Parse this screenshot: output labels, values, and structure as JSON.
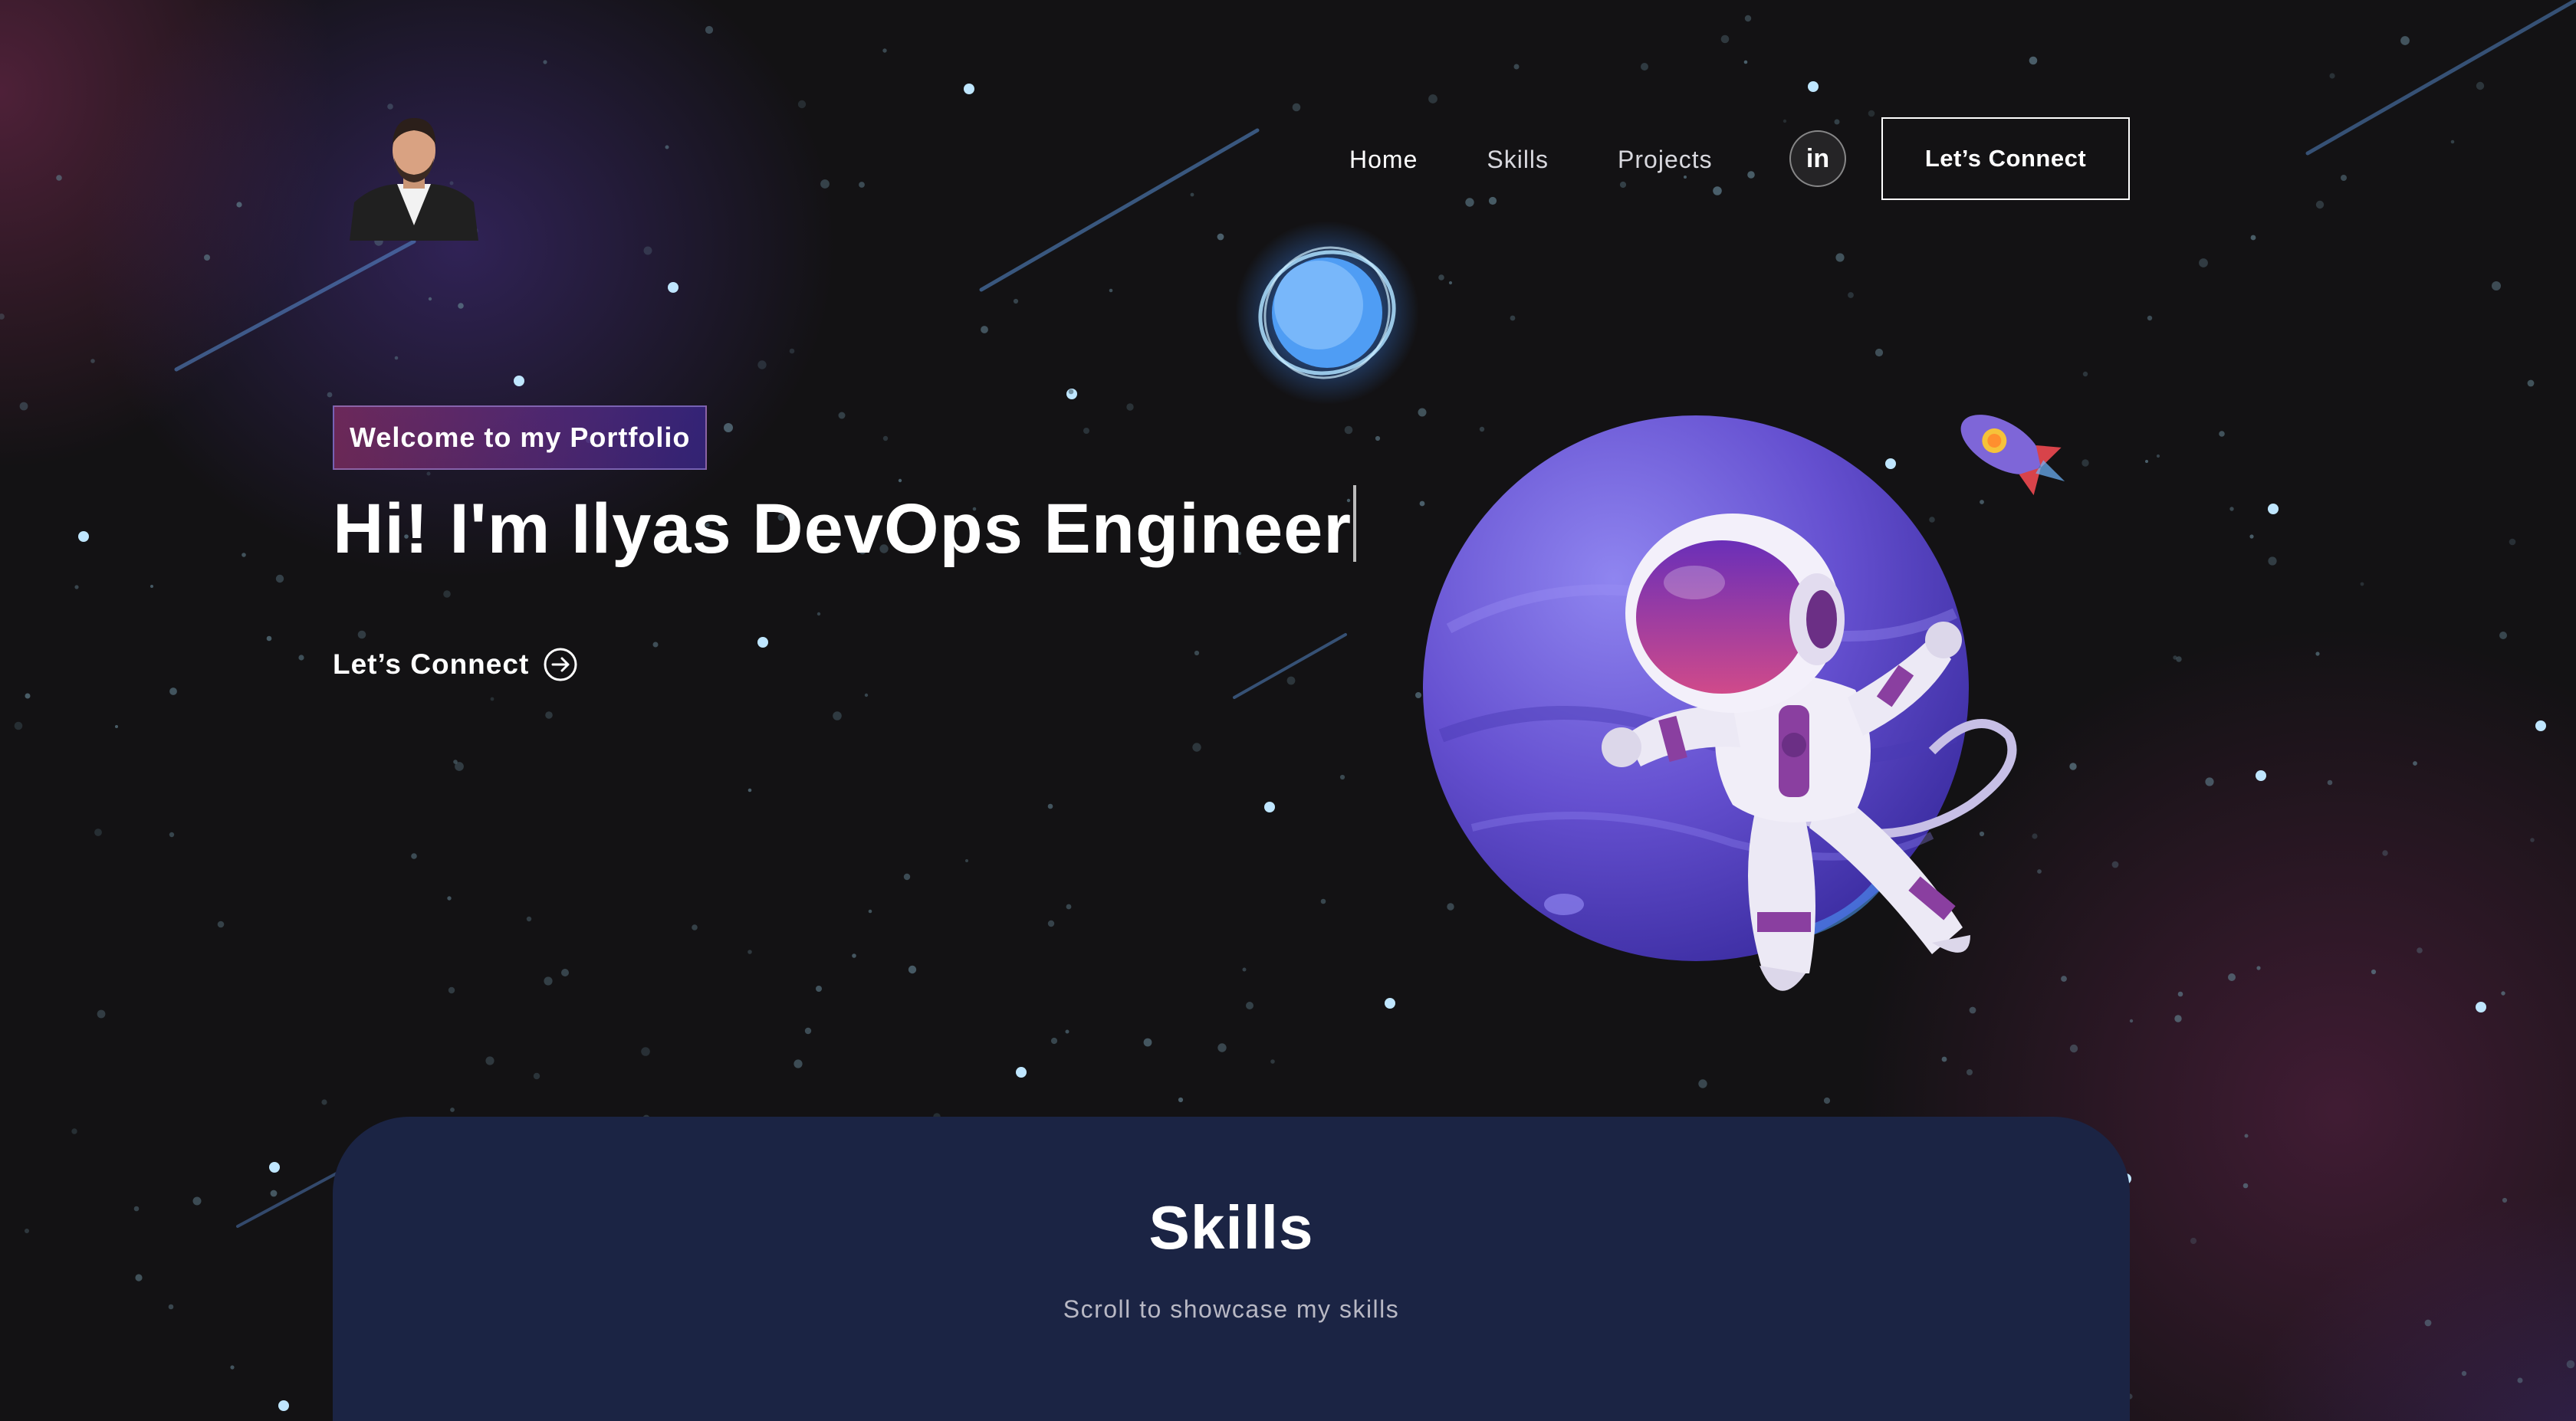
{
  "nav": {
    "links": [
      {
        "label": "Home"
      },
      {
        "label": "Skills"
      },
      {
        "label": "Projects"
      }
    ],
    "linkedin_label": "in",
    "connect_label": "Let’s Connect"
  },
  "hero": {
    "tagline": "Welcome to my Portfolio",
    "title": "Hi! I'm Ilyas DevOps Engineer",
    "cta_label": "Let’s Connect"
  },
  "skills": {
    "title": "Skills",
    "subtitle": "Scroll to showcase my skills"
  },
  "icons": {
    "cta_icon": "arrow-right-circle-icon",
    "linkedin_icon": "linkedin-icon"
  },
  "colors": {
    "background": "#131214",
    "skills_card": "#1b2444",
    "tagline_gradient_start": "#aa367c",
    "tagline_gradient_end": "#4a2fbd"
  }
}
